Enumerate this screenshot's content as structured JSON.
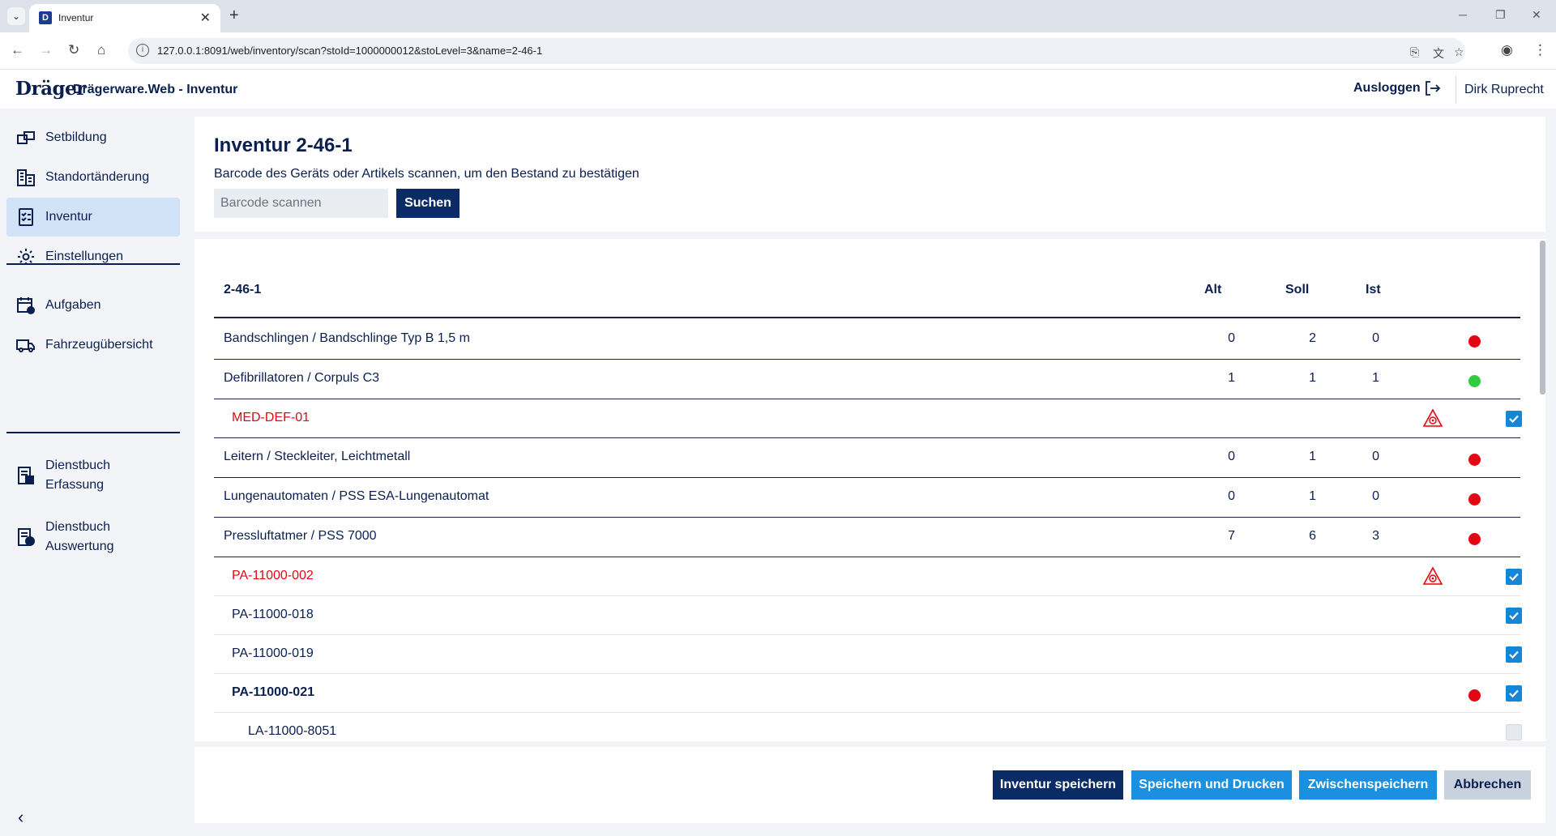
{
  "browser": {
    "tab_title": "Inventur",
    "tab_favicon_letter": "D",
    "url": "127.0.0.1:8091/web/inventory/scan?stoId=1000000012&stoLevel=3&name=2-46-1"
  },
  "header": {
    "logo": "Dräger",
    "app_title": "Drägerware.Web - Inventur",
    "logout_label": "Ausloggen",
    "username": "Dirk Ruprecht"
  },
  "sidebar": {
    "items": [
      {
        "label": "Setbildung",
        "icon": "set-icon"
      },
      {
        "label": "Standortänderung",
        "icon": "building-icon"
      },
      {
        "label": "Inventur",
        "icon": "checklist-icon",
        "active": true
      },
      {
        "label": "Einstellungen",
        "icon": "gear-icon"
      },
      {
        "label": "Aufgaben",
        "icon": "calendar-icon"
      },
      {
        "label": "Fahrzeugübersicht",
        "icon": "truck-icon"
      },
      {
        "label": "Dienstbuch\nErfassung",
        "icon": "logbook-edit-icon"
      },
      {
        "label": "Dienstbuch\nAuswertung",
        "icon": "logbook-check-icon"
      }
    ]
  },
  "page": {
    "title": "Inventur 2-46-1",
    "subtitle": "Barcode des Geräts oder Artikels scannen, um den Bestand zu bestätigen",
    "barcode_placeholder": "Barcode scannen",
    "search_label": "Suchen"
  },
  "table": {
    "headers": {
      "name": "2-46-1",
      "alt": "Alt",
      "soll": "Soll",
      "ist": "Ist"
    },
    "rows": [
      {
        "type": "group",
        "name": "Bandschlingen / Bandschlinge Typ B 1,5 m",
        "alt": "0",
        "soll": "2",
        "ist": "0",
        "status": "red"
      },
      {
        "type": "group",
        "name": "Defibrillatoren / Corpuls C3",
        "alt": "1",
        "soll": "1",
        "ist": "1",
        "status": "green"
      },
      {
        "type": "item",
        "name": "MED-DEF-01",
        "name_color": "red",
        "warning": true,
        "checked": true,
        "last": true
      },
      {
        "type": "group",
        "name": "Leitern / Steckleiter, Leichtmetall",
        "alt": "0",
        "soll": "1",
        "ist": "0",
        "status": "red"
      },
      {
        "type": "group",
        "name": "Lungenautomaten / PSS ESA-Lungenautomat",
        "alt": "0",
        "soll": "1",
        "ist": "0",
        "status": "red"
      },
      {
        "type": "group",
        "name": "Pressluftatmer / PSS 7000",
        "alt": "7",
        "soll": "6",
        "ist": "3",
        "status": "red"
      },
      {
        "type": "item",
        "name": "PA-11000-002",
        "name_color": "red",
        "warning": true,
        "checked": true
      },
      {
        "type": "item",
        "name": "PA-11000-018",
        "checked": true
      },
      {
        "type": "item",
        "name": "PA-11000-019",
        "checked": true
      },
      {
        "type": "item",
        "name": "PA-11000-021",
        "bold": true,
        "status": "red",
        "checked": true
      },
      {
        "type": "subitem",
        "name": "LA-11000-8051",
        "checked": false
      }
    ]
  },
  "footer": {
    "save_label": "Inventur speichern",
    "save_print_label": "Speichern und Drucken",
    "temp_save_label": "Zwischenspeichern",
    "cancel_label": "Abbrechen"
  },
  "colors": {
    "primary": "#0b2b66",
    "accent": "#1b90e0",
    "status_red": "#e30613",
    "status_green": "#2ecc40",
    "active_nav": "#d2e3f7"
  }
}
